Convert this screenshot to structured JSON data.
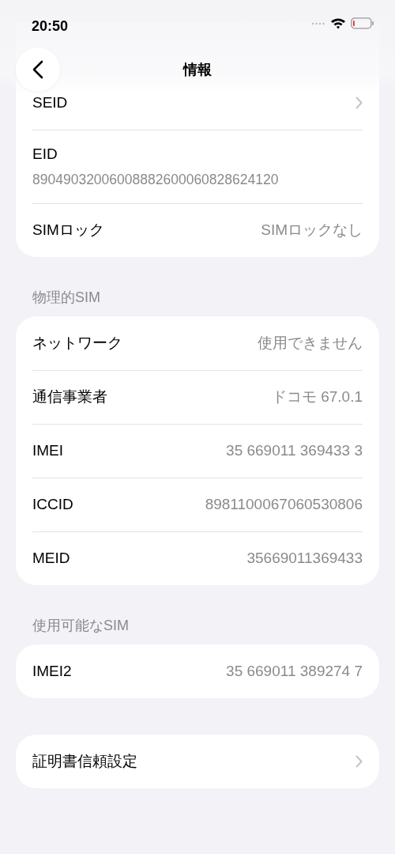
{
  "status_bar": {
    "time": "20:50"
  },
  "nav": {
    "title": "情報"
  },
  "groups": [
    {
      "rows": [
        {
          "kind": "chevron",
          "label": "SEID"
        },
        {
          "kind": "stacked",
          "label": "EID",
          "value": "89049032006008882600060828624120"
        },
        {
          "kind": "value",
          "label": "SIMロック",
          "value": "SIMロックなし"
        }
      ]
    },
    {
      "header": "物理的SIM",
      "rows": [
        {
          "kind": "value",
          "label": "ネットワーク",
          "value": "使用できません"
        },
        {
          "kind": "value",
          "label": "通信事業者",
          "value": "ドコモ 67.0.1"
        },
        {
          "kind": "value",
          "label": "IMEI",
          "value": "35 669011 369433 3"
        },
        {
          "kind": "value",
          "label": "ICCID",
          "value": "8981100067060530806"
        },
        {
          "kind": "value",
          "label": "MEID",
          "value": "35669011369433"
        }
      ]
    },
    {
      "header": "使用可能なSIM",
      "rows": [
        {
          "kind": "value",
          "label": "IMEI2",
          "value": "35 669011 389274 7"
        }
      ]
    },
    {
      "rows": [
        {
          "kind": "chevron",
          "label": "証明書信頼設定"
        }
      ]
    }
  ]
}
